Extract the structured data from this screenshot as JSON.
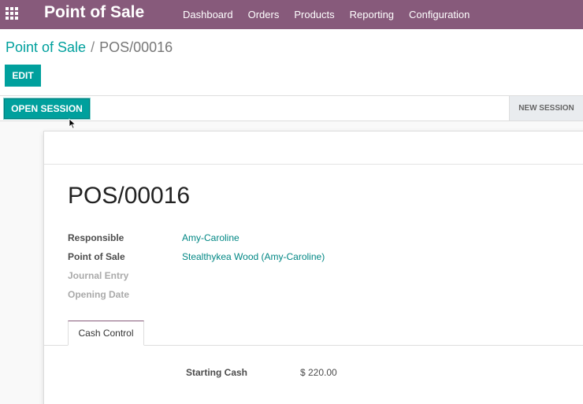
{
  "navbar": {
    "brand": "Point of Sale",
    "menu": [
      "Dashboard",
      "Orders",
      "Products",
      "Reporting",
      "Configuration"
    ]
  },
  "breadcrumb": {
    "parent": "Point of Sale",
    "separator": "/",
    "current": "POS/00016"
  },
  "buttons": {
    "edit": "EDIT",
    "open_session": "OPEN SESSION"
  },
  "status": {
    "new_session": "NEW SESSION"
  },
  "record": {
    "title": "POS/00016",
    "fields": [
      {
        "label": "Responsible",
        "value": "Amy-Caroline"
      },
      {
        "label": "Point of Sale",
        "value": "Stealthykea Wood (Amy-Caroline)"
      },
      {
        "label": "Journal Entry",
        "value": ""
      },
      {
        "label": "Opening Date",
        "value": ""
      }
    ]
  },
  "tabs": [
    "Cash Control"
  ],
  "cash_control": {
    "label": "Starting Cash",
    "value": "$ 220.00"
  },
  "colors": {
    "navbar": "#875a7b",
    "primary": "#00a09d"
  }
}
